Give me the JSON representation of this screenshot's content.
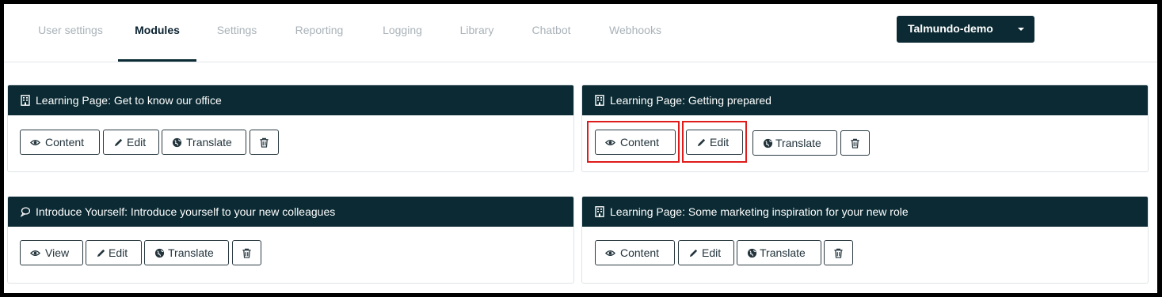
{
  "nav": {
    "tabs": [
      {
        "label": "User settings",
        "active": false
      },
      {
        "label": "Modules",
        "active": true
      },
      {
        "label": "Settings",
        "active": false
      },
      {
        "label": "Reporting",
        "active": false
      },
      {
        "label": "Logging",
        "active": false
      },
      {
        "label": "Library",
        "active": false
      },
      {
        "label": "Chatbot",
        "active": false
      },
      {
        "label": "Webhooks",
        "active": false
      }
    ],
    "organization": "Talmundo-demo"
  },
  "modules": [
    {
      "icon": "building-icon",
      "title": "Learning Page: Get to know our office",
      "buttons": {
        "content": "Content",
        "edit": "Edit",
        "translate": "Translate"
      }
    },
    {
      "icon": "building-icon",
      "title": "Learning Page: Getting prepared",
      "buttons": {
        "content": "Content",
        "edit": "Edit",
        "translate": "Translate"
      }
    },
    {
      "icon": "speech-bubble-icon",
      "title": "Introduce Yourself: Introduce yourself to your new colleagues",
      "buttons": {
        "content": "View",
        "edit": "Edit",
        "translate": "Translate"
      }
    },
    {
      "icon": "building-icon",
      "title": "Learning Page: Some marketing inspiration for your new role",
      "buttons": {
        "content": "Content",
        "edit": "Edit",
        "translate": "Translate"
      }
    }
  ],
  "colors": {
    "header": "#0b2a33",
    "highlight": "#e01b1b",
    "tab_inactive": "#a9b2b8"
  }
}
